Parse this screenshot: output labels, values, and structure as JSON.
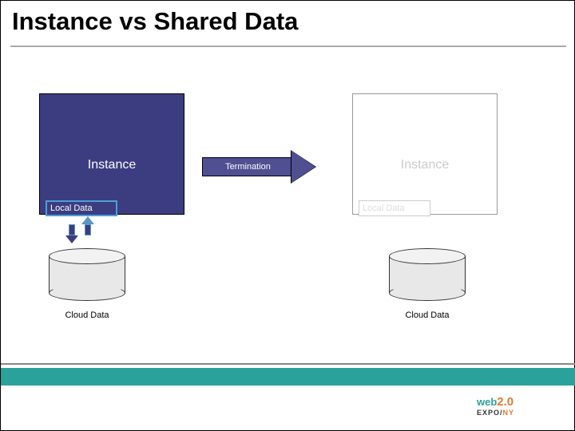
{
  "title": "Instance vs Shared Data",
  "left": {
    "instance_label": "Instance",
    "local_data_label": "Local Data",
    "cloud_label": "Cloud Data"
  },
  "arrow": {
    "label": "Termination"
  },
  "right": {
    "instance_label": "Instance",
    "local_data_label": "Local Data",
    "cloud_label": "Cloud Data"
  },
  "logo": {
    "web": "web",
    "two_o": "2.0",
    "expo": "EXPO",
    "slash": "/",
    "ny": "NY"
  }
}
